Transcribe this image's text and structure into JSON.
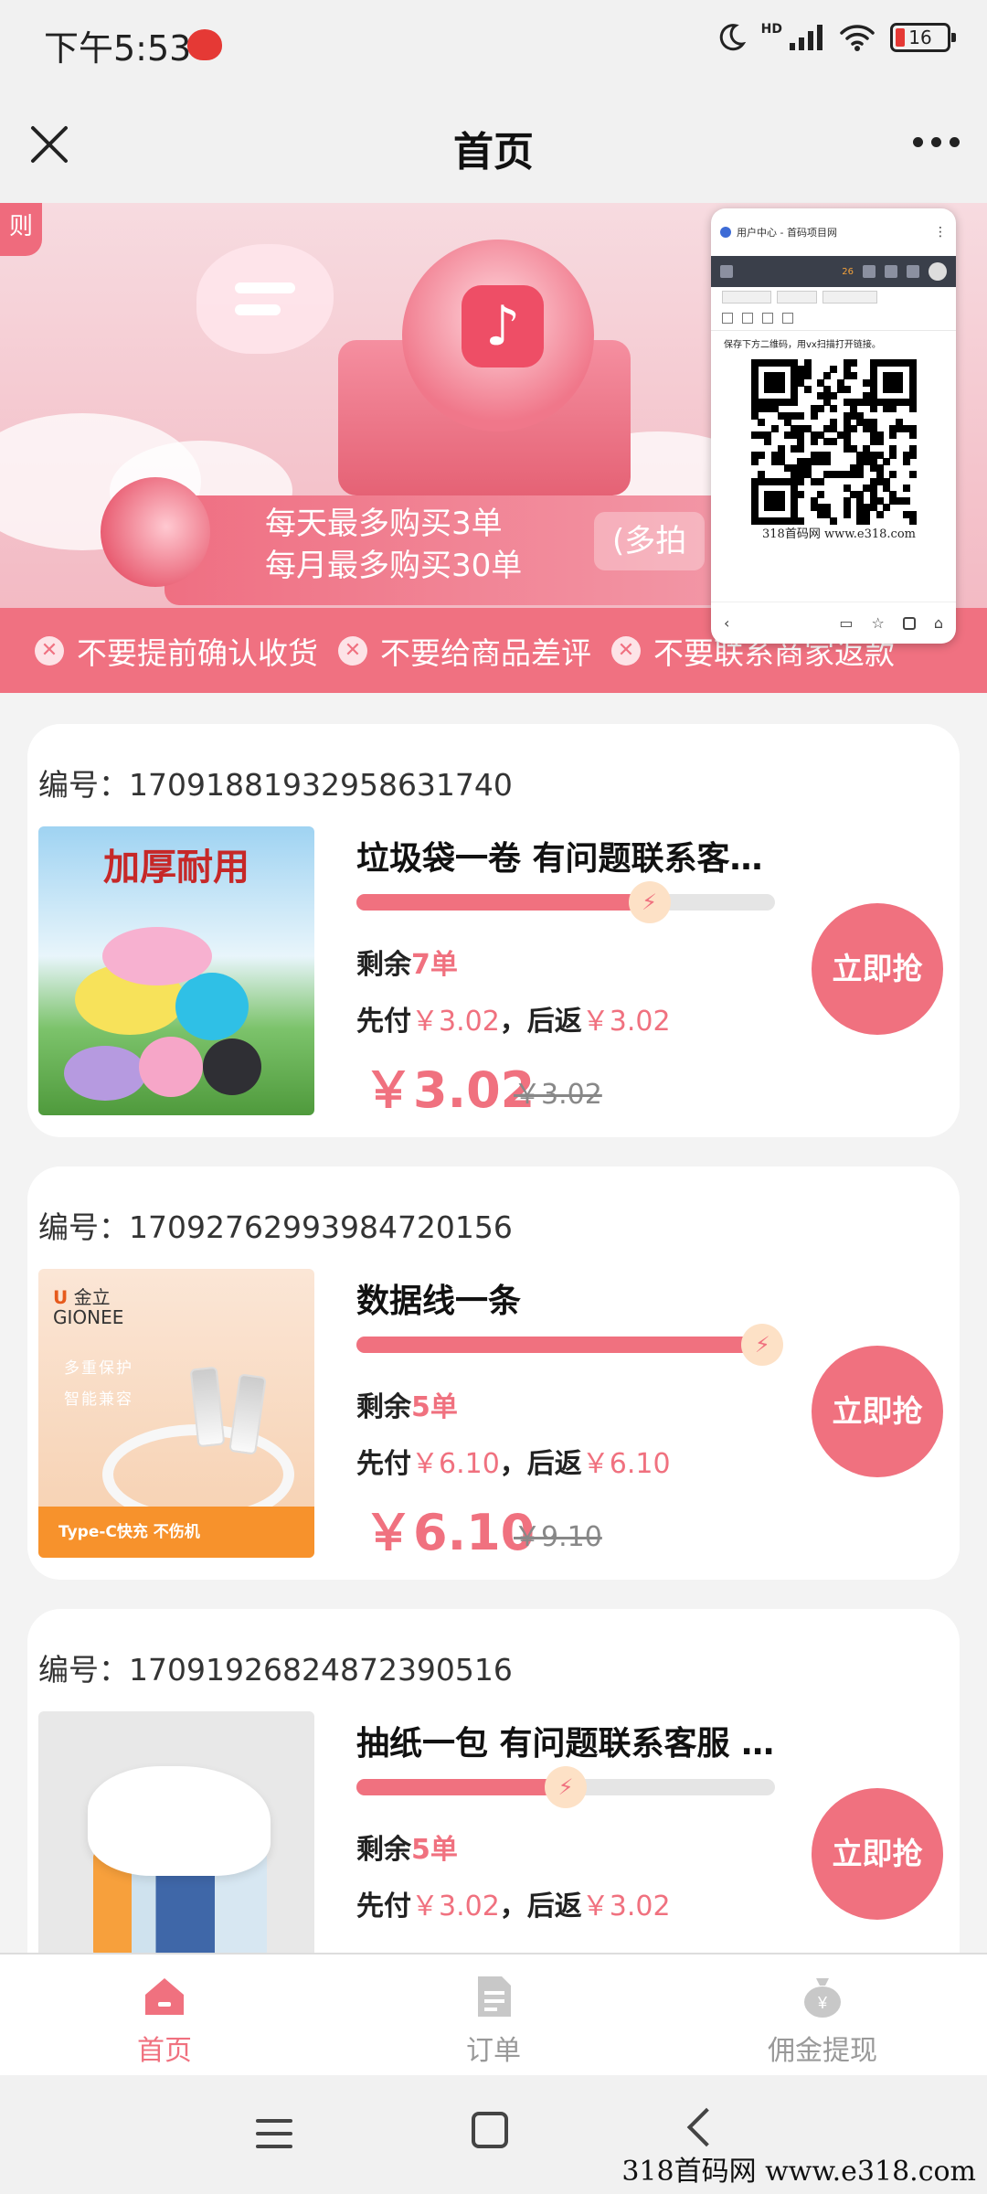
{
  "status_bar": {
    "time": "下午5:53",
    "battery": "16",
    "network": "HD"
  },
  "header": {
    "title": "首页"
  },
  "banner": {
    "corner_tag": "则",
    "rule_line1": "每天最多购买3单",
    "rule_line2": "每月最多购买30单",
    "rule_note": "(多拍",
    "strip_items": [
      "不要提前确认收货",
      "不要给商品差评",
      "不要联系商家返款"
    ]
  },
  "qr_popup": {
    "title": "用户中心 - 首码项目网",
    "badge": "26",
    "tip": "保存下方二维码，用vx扫描打开链接。",
    "caption": "318首码网 www.e318.com"
  },
  "products": [
    {
      "order_no_label": "编号：",
      "order_no": "17091881932958631740",
      "title": "垃圾袋一卷 有问题联系客…",
      "progress": 0.7,
      "remain_prefix": "剩余",
      "remain_count": "7单",
      "pay_prefix": "先付",
      "pay_amount": "￥3.02",
      "refund_prefix": "，后返",
      "refund_amount": "￥3.02",
      "price": "￥3.02",
      "original_price": "￥3.02",
      "buy_label": "立即抢",
      "image_caption": "加厚耐用"
    },
    {
      "order_no_label": "编号：",
      "order_no": "17092762993984720156",
      "title": "数据线一条",
      "progress": 0.97,
      "remain_prefix": "剩余",
      "remain_count": "5单",
      "pay_prefix": "先付",
      "pay_amount": "￥6.10",
      "refund_prefix": "，后返",
      "refund_amount": "￥6.10",
      "price": "￥6.10",
      "original_price": "￥9.10",
      "buy_label": "立即抢",
      "image_brand": "金立",
      "image_brand_en": "GIONEE",
      "image_feature1": "多重保护",
      "image_feature2": "智能兼容",
      "image_caption": "Type-C快充 不伤机"
    },
    {
      "order_no_label": "编号：",
      "order_no": "17091926824872390516",
      "title": "抽纸一包 有问题联系客服 …",
      "progress": 0.5,
      "remain_prefix": "剩余",
      "remain_count": "5单",
      "pay_prefix": "先付",
      "pay_amount": "￥3.02",
      "refund_prefix": "，后返",
      "refund_amount": "￥3.02",
      "buy_label": "立即抢"
    }
  ],
  "tabbar": {
    "tabs": [
      {
        "label": "首页",
        "active": true
      },
      {
        "label": "订单",
        "active": false
      },
      {
        "label": "佣金提现",
        "active": false
      }
    ]
  },
  "watermark": "318首码网 www.e318.com",
  "colors": {
    "accent": "#f0717f",
    "banner": "#f4c4cc"
  }
}
